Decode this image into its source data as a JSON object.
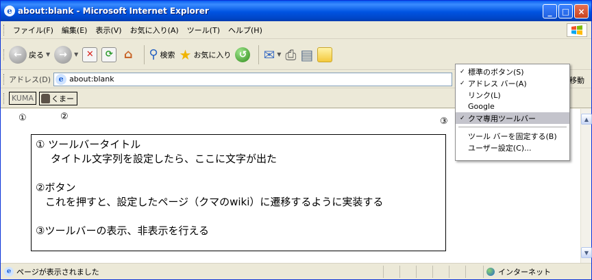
{
  "window": {
    "title": "about:blank - Microsoft Internet Explorer",
    "title_icon": "e",
    "buttons": {
      "minimize": "_",
      "maximize": "□",
      "close": "×"
    }
  },
  "menubar": {
    "items": [
      "ファイル(F)",
      "編集(E)",
      "表示(V)",
      "お気に入り(A)",
      "ツール(T)",
      "ヘルプ(H)"
    ]
  },
  "toolbar": {
    "back_label": "戻る",
    "back_glyph": "←",
    "forward_glyph": "→",
    "dropdown_glyph": "▼",
    "stop_glyph": "✕",
    "refresh_glyph": "⟳",
    "home_glyph": "⌂",
    "search_glyph": "⚲",
    "search_label": "検索",
    "favorites_glyph": "★",
    "favorites_label": "お気に入り",
    "history_glyph": "↺",
    "mail_glyph": "✉",
    "print_glyph": "⎙",
    "edit_glyph": "▤",
    "messenger_glyph": "▭"
  },
  "addressbar": {
    "label": "アドレス(D)",
    "icon": "e",
    "value": "about:blank",
    "go_label": "移動"
  },
  "kumabar": {
    "title": "KUMA",
    "button_label": "くまー"
  },
  "markers": {
    "one": "①",
    "two": "②",
    "three": "③"
  },
  "notes": {
    "line1": "① ツールバータイトル",
    "line2": "タイトル文字列を設定したら、ここに文字が出た",
    "line3": "②ボタン",
    "line4": "これを押すと、設定したページ（クマのwiki）に遷移するように実装する",
    "line5": "③ツールバーの表示、非表示を行える"
  },
  "context_menu": {
    "check_glyph": "✓",
    "items": [
      "標準のボタン(S)",
      "アドレス バー(A)",
      "リンク(L)",
      "Google",
      "クマ専用ツールバー"
    ],
    "items2": [
      "ツール バーを固定する(B)",
      "ユーザー設定(C)..."
    ]
  },
  "scrollbar": {
    "up": "▲",
    "down": "▼"
  },
  "status": {
    "icon": "e",
    "text": "ページが表示されました",
    "zone": "インターネット"
  },
  "colors": {
    "titlebar": "#0053e1",
    "menu_selected": "#c4c4cc",
    "chrome": "#ece9d8"
  }
}
